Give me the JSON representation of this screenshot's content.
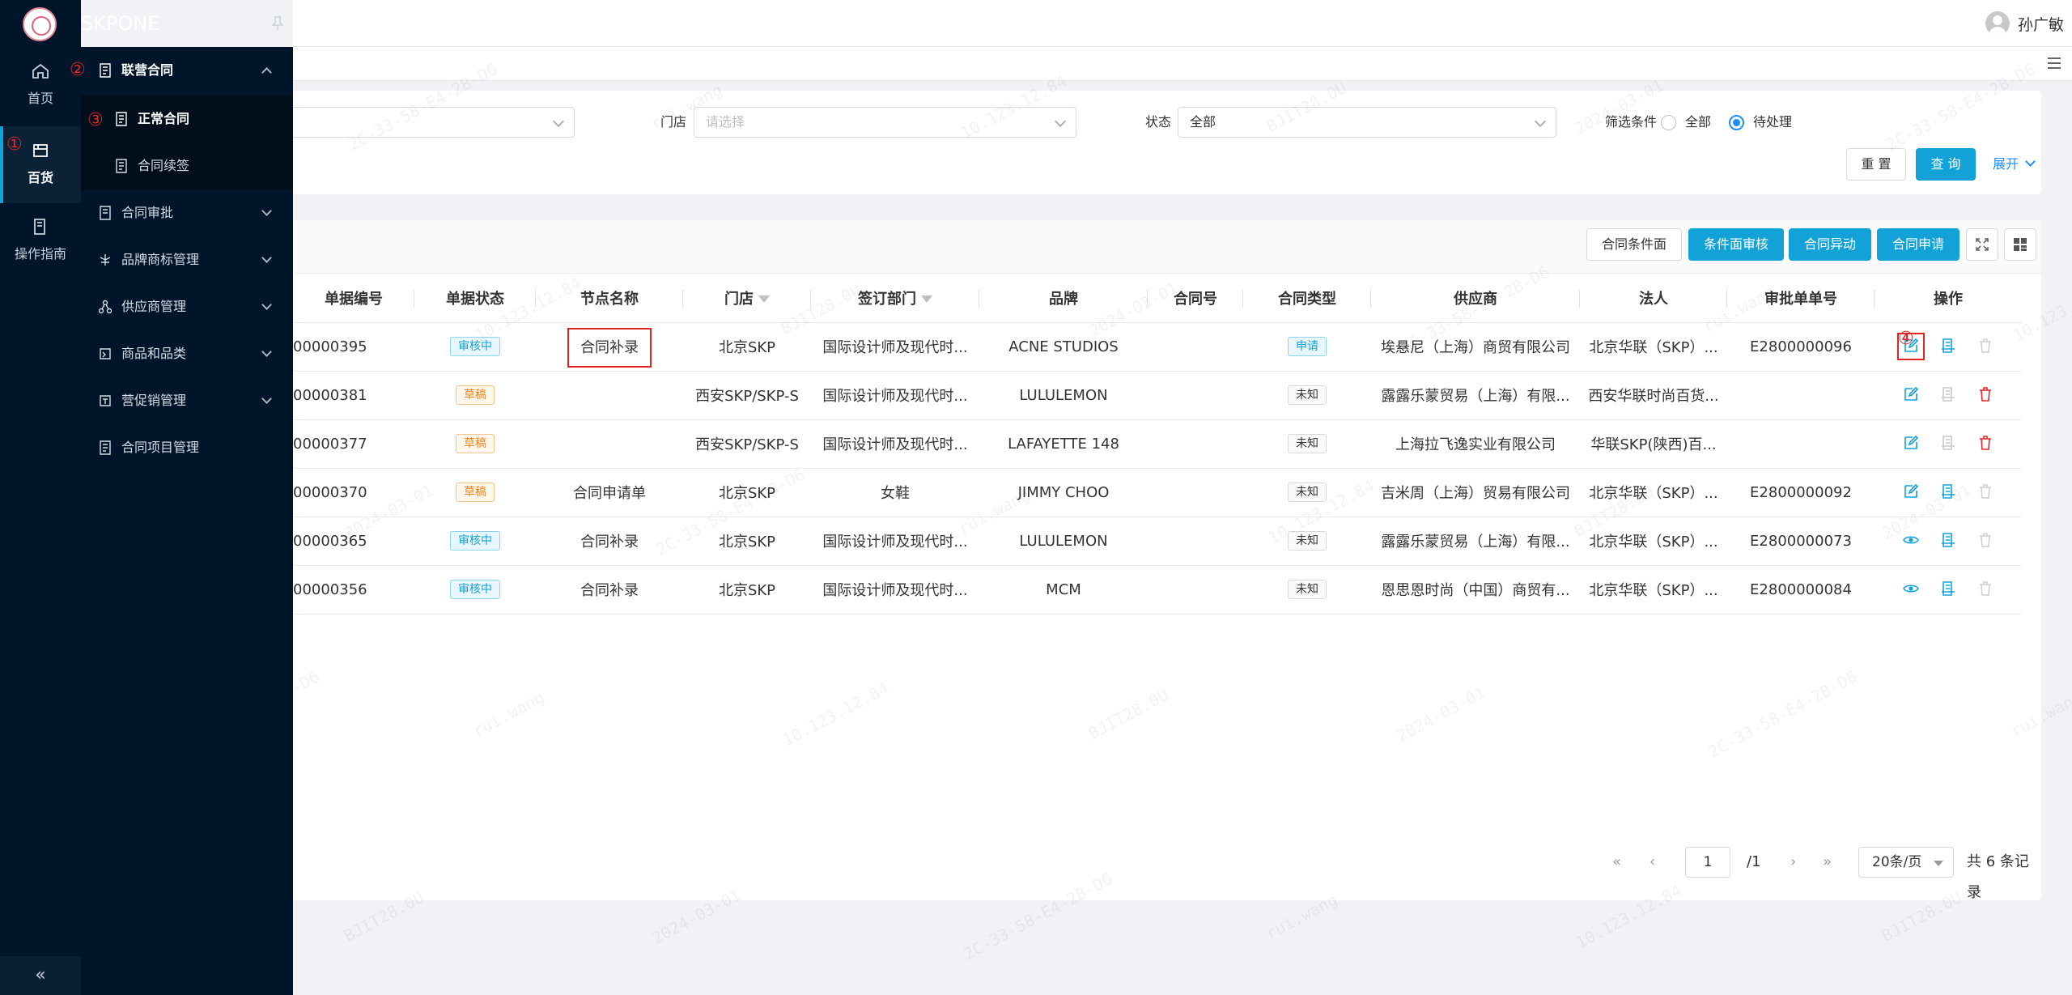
{
  "app": {
    "brand": "SKPONE",
    "user_name": "孙广敏"
  },
  "rail": [
    {
      "label": "首页",
      "icon": "home-icon",
      "active": false
    },
    {
      "label": "百货",
      "icon": "store-icon",
      "active": true
    },
    {
      "label": "操作指南",
      "icon": "book-icon",
      "active": false
    }
  ],
  "menu": {
    "group_open": "联营合同",
    "children": [
      "正常合同",
      "合同续签"
    ],
    "groups": [
      "合同审批",
      "品牌商标管理",
      "供应商管理",
      "商品和品类",
      "营促销管理",
      "合同项目管理"
    ]
  },
  "annotations": [
    "①",
    "②",
    "③",
    "④"
  ],
  "filters": {
    "store_label": "门店",
    "store_placeholder": "请选择",
    "status_label": "状态",
    "status_value": "全部",
    "condition_label": "筛选条件",
    "condition_options": [
      "全部",
      "待处理"
    ],
    "condition_selected": "待处理",
    "reset": "重 置",
    "query": "查 询",
    "expand": "展开"
  },
  "toolbar": {
    "btn_conditions": "合同条件面",
    "btn_review": "条件面审核",
    "btn_change": "合同异动",
    "btn_apply": "合同申请"
  },
  "table": {
    "headers": [
      "单据编号",
      "单据状态",
      "节点名称",
      "门店",
      "签订部门",
      "品牌",
      "合同号",
      "合同类型",
      "供应商",
      "法人",
      "审批单单号",
      "操作"
    ],
    "rows": [
      {
        "no": "00000395",
        "status": "审核中",
        "status_type": "review",
        "node": "合同补录",
        "store": "北京SKP",
        "dept": "国际设计师及现代时...",
        "brand": "ACNE STUDIOS",
        "contract_no": "",
        "type": "申请",
        "type_kind": "apply",
        "supplier": "埃悬尼（上海）商贸有限公司",
        "legal": "北京华联（SKP）...",
        "approval": "E2800000096",
        "view_icon": "edit-icon",
        "delete_active": false
      },
      {
        "no": "00000381",
        "status": "草稿",
        "status_type": "draft",
        "node": "",
        "store": "西安SKP/SKP-S",
        "dept": "国际设计师及现代时...",
        "brand": "LULULEMON",
        "contract_no": "",
        "type": "未知",
        "type_kind": "unknown",
        "supplier": "露露乐蒙贸易（上海）有限...",
        "legal": "西安华联时尚百货...",
        "approval": "",
        "view_icon": "edit-icon",
        "delete_active": true
      },
      {
        "no": "00000377",
        "status": "草稿",
        "status_type": "draft",
        "node": "",
        "store": "西安SKP/SKP-S",
        "dept": "国际设计师及现代时...",
        "brand": "LAFAYETTE 148",
        "contract_no": "",
        "type": "未知",
        "type_kind": "unknown",
        "supplier": "上海拉飞逸实业有限公司",
        "legal": "华联SKP(陕西)百...",
        "approval": "",
        "view_icon": "edit-icon",
        "delete_active": true
      },
      {
        "no": "00000370",
        "status": "草稿",
        "status_type": "draft",
        "node": "合同申请单",
        "store": "北京SKP",
        "dept": "女鞋",
        "brand": "JIMMY CHOO",
        "contract_no": "",
        "type": "未知",
        "type_kind": "unknown",
        "supplier": "吉米周（上海）贸易有限公司",
        "legal": "北京华联（SKP）...",
        "approval": "E2800000092",
        "view_icon": "edit-icon",
        "delete_active": false
      },
      {
        "no": "00000365",
        "status": "审核中",
        "status_type": "review",
        "node": "合同补录",
        "store": "北京SKP",
        "dept": "国际设计师及现代时...",
        "brand": "LULULEMON",
        "contract_no": "",
        "type": "未知",
        "type_kind": "unknown",
        "supplier": "露露乐蒙贸易（上海）有限...",
        "legal": "北京华联（SKP）...",
        "approval": "E2800000073",
        "view_icon": "eye-icon",
        "delete_active": false
      },
      {
        "no": "00000356",
        "status": "审核中",
        "status_type": "review",
        "node": "合同补录",
        "store": "北京SKP",
        "dept": "国际设计师及现代时...",
        "brand": "MCM",
        "contract_no": "",
        "type": "未知",
        "type_kind": "unknown",
        "supplier": "恩思恩时尚（中国）商贸有...",
        "legal": "北京华联（SKP）...",
        "approval": "E2800000084",
        "view_icon": "eye-icon",
        "delete_active": false
      }
    ]
  },
  "pagination": {
    "current": "1",
    "total_pages": "/1",
    "page_size": "20条/页",
    "summary": "共 6 条记录"
  },
  "watermark": {
    "texts": [
      "2024-03-01",
      "2C-33-58-E4-2B-D6",
      "rui.wang",
      "10.123.12.84",
      "BJIT28.0U"
    ]
  },
  "colors": {
    "sidebar": "#001529",
    "primary": "#13a2d8",
    "annotation": "#e02424"
  }
}
